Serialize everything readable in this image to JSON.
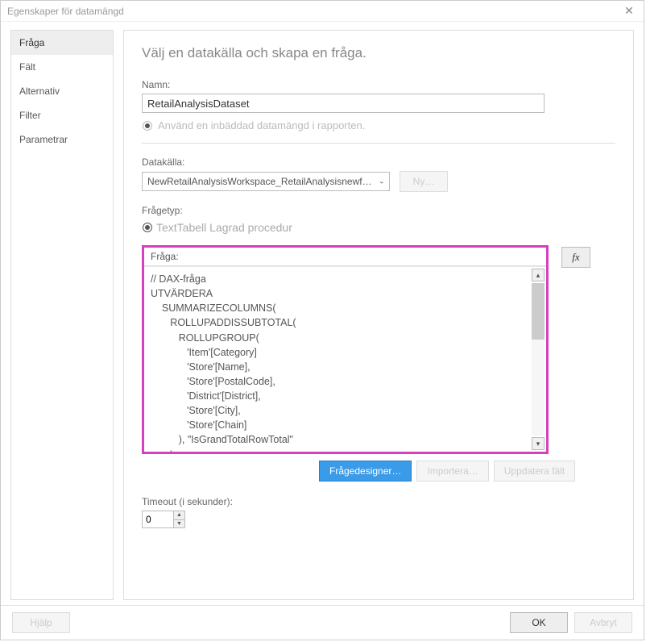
{
  "title": "Egenskaper för datamängd",
  "sidebar": {
    "items": [
      {
        "label": "Fråga"
      },
      {
        "label": "Fält"
      },
      {
        "label": "Alternativ"
      },
      {
        "label": "Filter"
      },
      {
        "label": "Parametrar"
      }
    ]
  },
  "main": {
    "instruction": "Välj en datakälla och skapa en fråga.",
    "name_label": "Namn:",
    "name_value": "RetailAnalysisDataset",
    "embedded_label": "Använd en inbäddad datamängd i rapporten.",
    "datasource_label": "Datakälla:",
    "datasource_selected": "NewRetailAnalysisWorkspace_RetailAnalysisnewfilterssl",
    "new_button": "Ny…",
    "querytype_label": "Frågetyp:",
    "querytype_options": "TextTabell Lagrad procedur",
    "query_label": "Fråga:",
    "query_text": "// DAX-fråga\nUTVÄRDERA\n    SUMMARIZECOLUMNS(\n       ROLLUPADDISSUBTOTAL(\n          ROLLUPGROUP(\n             'Item'[Category]\n             'Store'[Name],\n             'Store'[PostalCode],\n             'District'[District],\n             'Store'[City],\n             'Store'[Chain]\n          ), \"IsGrandTotalRowTotal\"\n       ),\n       \"This_Year_Sales\", 'Sales'[This Year Sales]",
    "fx_label": "fx",
    "action_designer": "Frågedesigner…",
    "action_import": "Importera…",
    "action_refresh": "Uppdatera fält",
    "timeout_label": "Timeout (i sekunder):",
    "timeout_value": "0"
  },
  "footer": {
    "help": "Hjälp",
    "ok": "OK",
    "cancel": "Avbryt"
  }
}
